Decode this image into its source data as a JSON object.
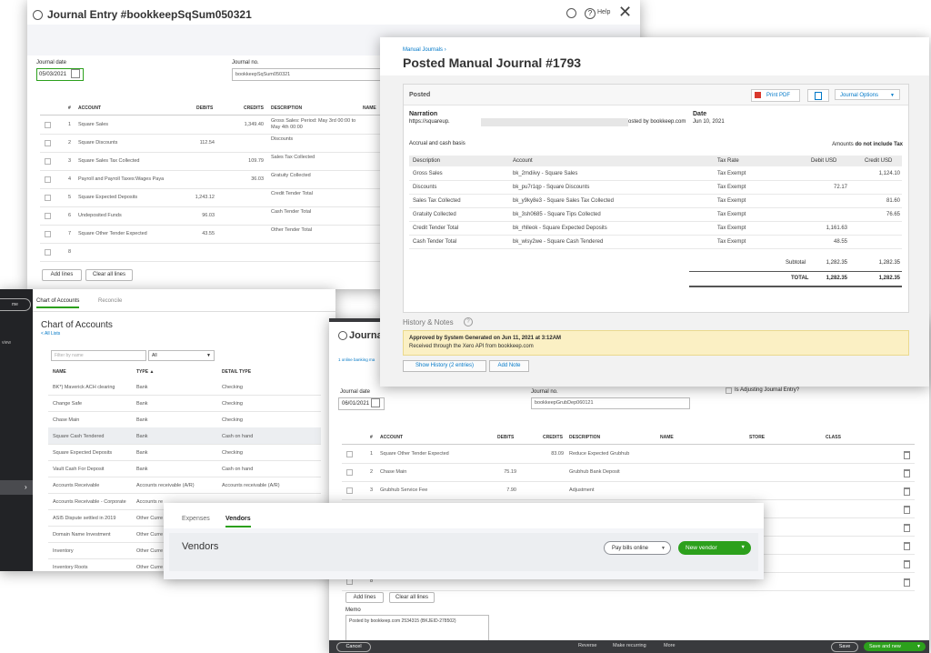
{
  "journal_entry": {
    "title": "Journal Entry #bookkeepSqSum050321",
    "help_label": "Help",
    "journal_date_label": "Journal date",
    "journal_date_value": "05/03/2021",
    "journal_no_label": "Journal no.",
    "journal_no_value": "bookkeepSqSum050321",
    "columns": [
      "#",
      "ACCOUNT",
      "DEBITS",
      "CREDITS",
      "DESCRIPTION",
      "NAME"
    ],
    "rows": [
      {
        "num": "1",
        "account": "Square Sales",
        "debit": "",
        "credit": "1,349.40",
        "description": "Gross Sales: Period: May 3rd 00:00 to May 4th 00:00"
      },
      {
        "num": "2",
        "account": "Square Discounts",
        "debit": "112.54",
        "credit": "",
        "description": "Discounts"
      },
      {
        "num": "3",
        "account": "Square Sales Tax Collected",
        "debit": "",
        "credit": "109.79",
        "description": "Sales Tax Collected"
      },
      {
        "num": "4",
        "account": "Payroll and Payroll Taxes:Wages Paya",
        "debit": "",
        "credit": "36.03",
        "description": "Gratuity Collected"
      },
      {
        "num": "5",
        "account": "Square Expected Deposits",
        "debit": "1,243.12",
        "credit": "",
        "description": "Credit Tender Total"
      },
      {
        "num": "6",
        "account": "Undeposited Funds",
        "debit": "96.03",
        "credit": "",
        "description": "Cash Tender Total"
      },
      {
        "num": "7",
        "account": "Square Other Tender Expected",
        "debit": "43.55",
        "credit": "",
        "description": "Other Tender Total"
      },
      {
        "num": "8",
        "account": "",
        "debit": "",
        "credit": "",
        "description": ""
      }
    ],
    "add_lines": "Add lines",
    "clear_all_lines": "Clear all lines"
  },
  "manual_journal": {
    "breadcrumb": "Manual Journals ›",
    "title": "Posted Manual Journal #1793",
    "status": "Posted",
    "print_pdf": "Print PDF",
    "journal_options": "Journal Options",
    "narration_label": "Narration",
    "narration_value_start": "https://squareup.",
    "narration_value_end": "osted by bookkeep.com",
    "date_label": "Date",
    "date_value": "Jun 10, 2021",
    "basis": "Accrual and cash basis",
    "amounts_prefix": "Amounts",
    "amounts_bold": "do not include Tax",
    "columns": [
      "Description",
      "Account",
      "Tax Rate",
      "Debit USD",
      "Credit USD"
    ],
    "rows": [
      {
        "description": "Gross Sales",
        "account": "bk_2mdiivy - Square Sales",
        "tax": "Tax Exempt",
        "debit": "",
        "credit": "1,124.10"
      },
      {
        "description": "Discounts",
        "account": "bk_pu7r1qp - Square Discounts",
        "tax": "Tax Exempt",
        "debit": "72.17",
        "credit": ""
      },
      {
        "description": "Sales Tax Collected",
        "account": "bk_y9ky8e3 - Square Sales Tax Collected",
        "tax": "Tax Exempt",
        "debit": "",
        "credit": "81.60"
      },
      {
        "description": "Gratuity Collected",
        "account": "bk_3sh0685 - Square Tips Collected",
        "tax": "Tax Exempt",
        "debit": "",
        "credit": "76.65"
      },
      {
        "description": "Credit Tender Total",
        "account": "bk_rhlleok - Square Expected Deposits",
        "tax": "Tax Exempt",
        "debit": "1,161.63",
        "credit": ""
      },
      {
        "description": "Cash Tender Total",
        "account": "bk_wlsy2we - Square Cash Tendered",
        "tax": "Tax Exempt",
        "debit": "48.55",
        "credit": ""
      }
    ],
    "subtotal_label": "Subtotal",
    "subtotal_debit": "1,282.35",
    "subtotal_credit": "1,282.35",
    "total_label": "TOTAL",
    "total_debit": "1,282.35",
    "total_credit": "1,282.35",
    "history_title": "History & Notes",
    "history_approved": "Approved by System Generated on Jun 11, 2021 at 3:12AM",
    "history_received": "Received through the Xero API from bookkeep.com",
    "show_history": "Show History (2 entries)",
    "add_note": "Add Note"
  },
  "chart_of_accounts": {
    "tab_active": "Chart of Accounts",
    "tab_other": "Reconcile",
    "title": "Chart of Accounts",
    "all_lists": "< All Lists",
    "filter_placeholder": "Filter by name",
    "filter_select": "All",
    "sidebar_top": "me",
    "sidebar_item": "view",
    "columns": [
      "NAME",
      "TYPE ▲",
      "DETAIL TYPE"
    ],
    "rows": [
      {
        "name": "BK*) Maverick ACH clearing",
        "type": "Bank",
        "detail": "Checking"
      },
      {
        "name": "Change Safe",
        "type": "Bank",
        "detail": "Checking"
      },
      {
        "name": "Chase Main",
        "type": "Bank",
        "detail": "Checking"
      },
      {
        "name": "Square Cash Tendered",
        "type": "Bank",
        "detail": "Cash on hand"
      },
      {
        "name": "Square Expected Deposits",
        "type": "Bank",
        "detail": "Checking"
      },
      {
        "name": "Vault Cash For Deposit",
        "type": "Bank",
        "detail": "Cash on hand"
      },
      {
        "name": "Accounts Receivable",
        "type": "Accounts receivable (A/R)",
        "detail": "Accounts receivable (A/R)"
      },
      {
        "name": "Accounts Receivable - Corporate",
        "type": "Accounts re",
        "detail": ""
      },
      {
        "name": "ASI5 Dispute settled in 2019",
        "type": "Other Curre",
        "detail": ""
      },
      {
        "name": "Domain Name Investment",
        "type": "Other Curre",
        "detail": ""
      },
      {
        "name": "Inventory",
        "type": "Other Curre",
        "detail": ""
      },
      {
        "name": "Inventory Roots",
        "type": "Other Curre",
        "detail": ""
      }
    ]
  },
  "journal_entry_2": {
    "title": "Journa",
    "banner": "1 online banking ma",
    "journal_date_label": "Journal date",
    "journal_date_value": "06/01/2021",
    "journal_no_label": "Journal no.",
    "journal_no_value": "bookkeepGrubDep060121",
    "adjusting_label": "Is Adjusting Journal Entry?",
    "columns": [
      "#",
      "ACCOUNT",
      "DEBITS",
      "CREDITS",
      "DESCRIPTION",
      "NAME",
      "STORE",
      "CLASS"
    ],
    "rows": [
      {
        "num": "1",
        "account": "Square Other Tender Expected",
        "debit": "",
        "credit": "83.09",
        "description": "Reduce Expected Grubhub"
      },
      {
        "num": "2",
        "account": "Chase Main",
        "debit": "75.19",
        "credit": "",
        "description": "Grubhub Bank Deposit"
      },
      {
        "num": "3",
        "account": "Grubhub Service Fee",
        "debit": "7.90",
        "credit": "",
        "description": "Adjustment"
      },
      {
        "num": "4",
        "account": "",
        "debit": "",
        "credit": "",
        "description": ""
      },
      {
        "num": "5",
        "account": "",
        "debit": "",
        "credit": "",
        "description": ""
      },
      {
        "num": "6",
        "account": "",
        "debit": "",
        "credit": "",
        "description": ""
      },
      {
        "num": "7",
        "account": "",
        "debit": "",
        "credit": "",
        "description": ""
      },
      {
        "num": "8",
        "account": "",
        "debit": "",
        "credit": "",
        "description": ""
      }
    ],
    "add_lines": "Add lines",
    "clear_all_lines": "Clear all lines",
    "memo_label": "Memo",
    "memo_value": "Posted by bookkeep.com   2534315 (BKJEID-278502)",
    "footer": {
      "cancel": "Cancel",
      "reverse": "Reverse",
      "make_recurring": "Make recurring",
      "more": "More",
      "save": "Save",
      "save_and_new": "Save and new"
    }
  },
  "vendors": {
    "tab_expenses": "Expenses",
    "tab_vendors": "Vendors",
    "title": "Vendors",
    "pay_bills": "Pay bills online",
    "new_vendor": "New vendor"
  },
  "colors": {
    "qb_green": "#2ca01c",
    "xero_blue": "#0078c8",
    "highlight_yellow": "#fbf0c4",
    "dark_footer": "#393a3d"
  }
}
